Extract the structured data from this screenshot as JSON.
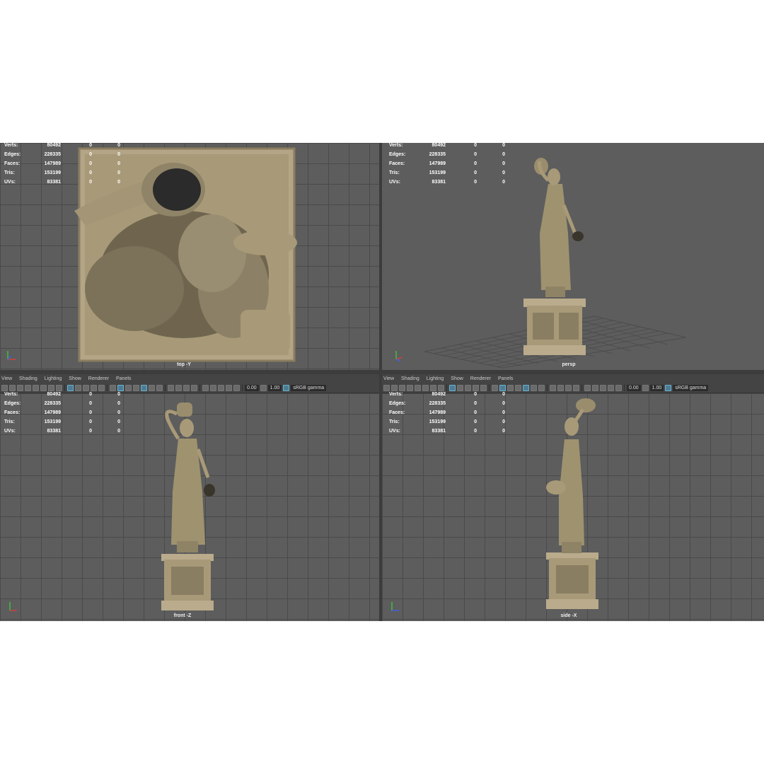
{
  "menu": [
    "View",
    "Shading",
    "Lighting",
    "Show",
    "Renderer",
    "Panels"
  ],
  "toolbar": {
    "value_a": "0.00",
    "value_b": "1.00",
    "color_space": "sRGB gamma"
  },
  "hud": {
    "labels": [
      "Verts:",
      "Edges:",
      "Faces:",
      "Tris:",
      "UVs:"
    ],
    "values": [
      "80492",
      "228335",
      "147989",
      "153199",
      "83381"
    ],
    "col2": "0",
    "col3": "0"
  },
  "viewports": {
    "top": {
      "camera": "top -Y"
    },
    "persp": {
      "camera": "persp"
    },
    "front": {
      "camera": "front -Z"
    },
    "side": {
      "camera": "side -X"
    }
  },
  "colors": {
    "stone": "#b9ab8c",
    "stone_dark": "#6e6450",
    "viewport_bg": "#5d5d5d",
    "grid": "#4a4a4a",
    "accent": "#4d7d95"
  },
  "icons": [
    "camera-icon",
    "grid-icon",
    "shading-icon",
    "lighting-icon",
    "isolate-icon",
    "xray-icon",
    "gamma-icon"
  ]
}
